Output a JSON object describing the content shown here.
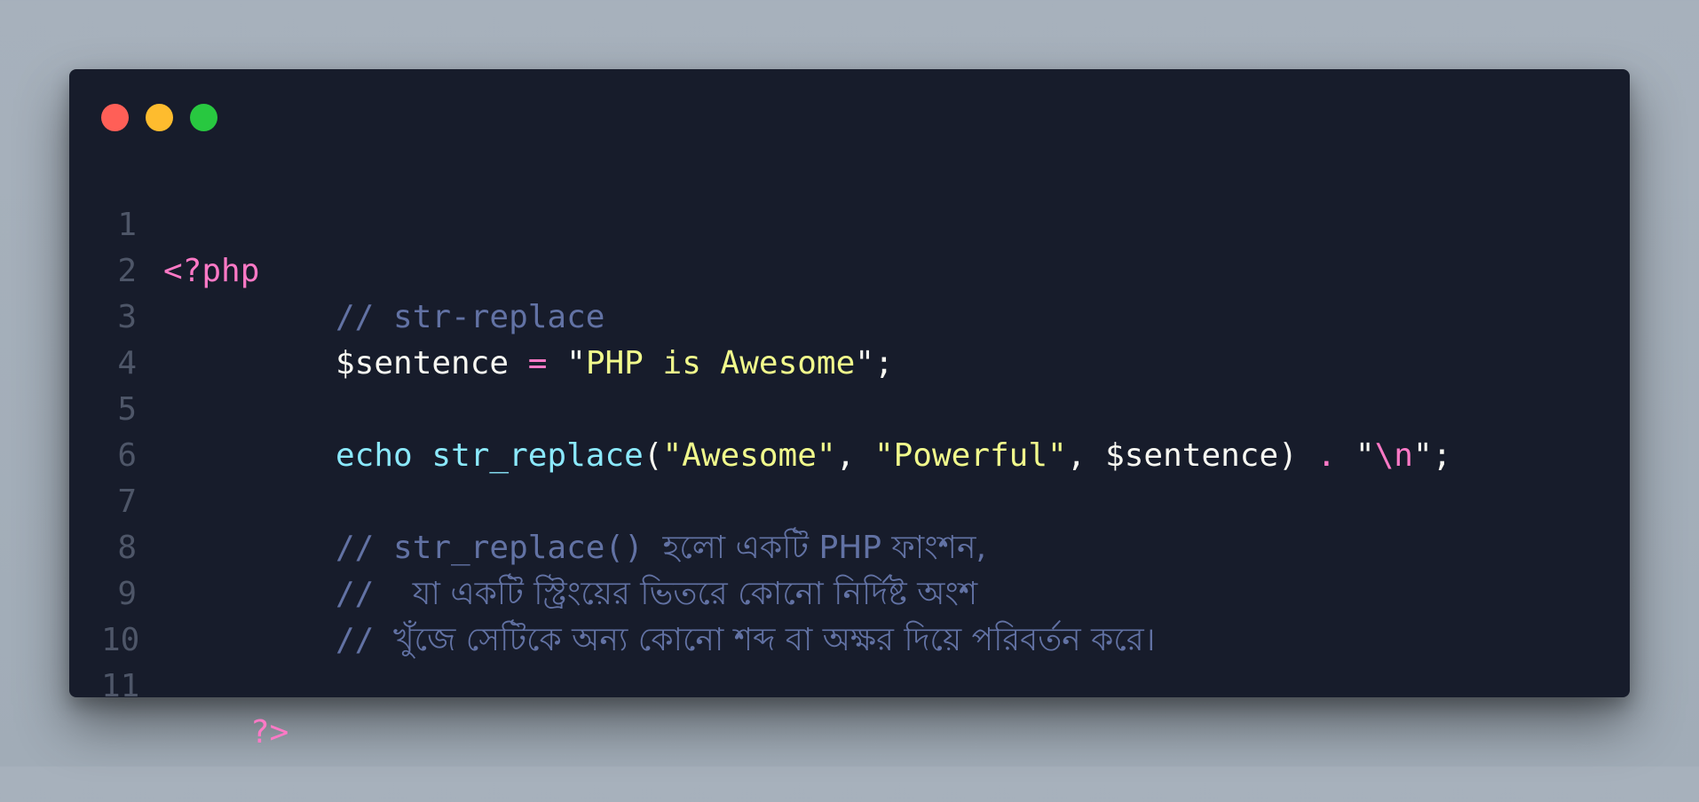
{
  "window": {
    "controls": [
      "close",
      "minimize",
      "maximize"
    ],
    "colors": {
      "background": "#171c2b",
      "close": "#ff5f57",
      "minimize": "#febc2e",
      "maximize": "#28c840"
    }
  },
  "code": {
    "language": "php",
    "lines": [
      {
        "num": "1",
        "open_tag": "<?php"
      },
      {
        "num": "2",
        "comment": "// str-replace"
      },
      {
        "num": "3",
        "var": "$sentence",
        "op": "=",
        "str_open": "\"",
        "str_body": "PHP is Awesome",
        "str_close": "\"",
        "end": ";"
      },
      {
        "num": "4"
      },
      {
        "num": "5",
        "kw": "echo",
        "fn": "str_replace",
        "paren_open": "(",
        "arg1": "\"Awesome\"",
        "comma1": ",",
        "arg2": "\"Powerful\"",
        "comma2": ",",
        "arg3": "$sentence",
        "paren_close": ")",
        "concat": ".",
        "q1": "\"",
        "esc": "\\n",
        "q2": "\"",
        "end": ";"
      },
      {
        "num": "6"
      },
      {
        "num": "7",
        "comment_prefix": "// str_replace() ",
        "comment_text": "হলো একটি PHP ফাংশন,"
      },
      {
        "num": "8",
        "comment_prefix": "//  ",
        "comment_text": "যা একটি স্ট্রিংয়ের ভিতরে কোনো নির্দিষ্ট অংশ"
      },
      {
        "num": "9",
        "comment_prefix": "// ",
        "comment_text": "খুঁজে সেটিকে অন্য কোনো শব্দ বা অক্ষর দিয়ে পরিবর্তন করে।"
      },
      {
        "num": "10"
      },
      {
        "num": "11",
        "close_tag": "?>"
      }
    ]
  }
}
